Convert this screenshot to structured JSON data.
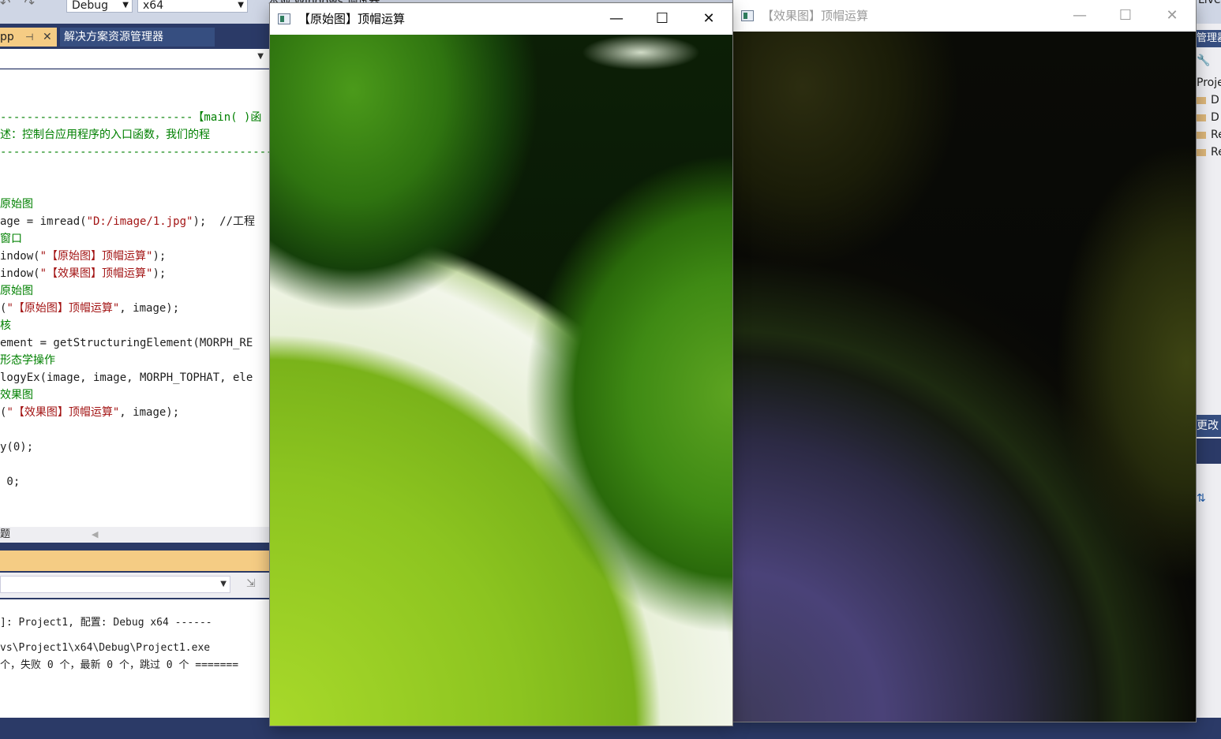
{
  "vs": {
    "toolbar": {
      "nav_arrows": "↶ ↷",
      "config": "Debug",
      "platform": "x64",
      "run_target": "本地 Windows 调试器",
      "live_share": "Live"
    },
    "tabs": {
      "cpp_tab": "pp",
      "pin_glyph": "⊣",
      "close_glyph": "✕",
      "solution_explorer": "解决方案资源管理器"
    },
    "code_lines": [
      {
        "text": "-----------------------------【main( )函",
        "color": "green"
      },
      {
        "text": "述：控制台应用程序的入口函数，我们的程",
        "color": "green"
      },
      {
        "text": "------------------------------------------",
        "color": "green"
      },
      {
        "text": "",
        "color": "dark"
      },
      {
        "text": "",
        "color": "dark"
      },
      {
        "text": "原始图",
        "color": "green"
      },
      {
        "text": "age = imread(\"D:/image/1.jpg\");  //工程",
        "color": "dark"
      },
      {
        "text": "窗口",
        "color": "green"
      },
      {
        "text": "indow(\"【原始图】顶帽运算\");",
        "color": "dark"
      },
      {
        "text": "indow(\"【效果图】顶帽运算\");",
        "color": "dark"
      },
      {
        "text": "原始图",
        "color": "green"
      },
      {
        "text": "(\"【原始图】顶帽运算\", image);",
        "color": "dark"
      },
      {
        "text": "核",
        "color": "green"
      },
      {
        "text": "ement = getStructuringElement(MORPH_RE",
        "color": "dark"
      },
      {
        "text": "形态学操作",
        "color": "green"
      },
      {
        "text": "logyEx(image, image, MORPH_TOPHAT, ele",
        "color": "dark"
      },
      {
        "text": "效果图",
        "color": "green"
      },
      {
        "text": "(\"【效果图】顶帽运算\", image);",
        "color": "dark"
      },
      {
        "text": "",
        "color": "dark"
      },
      {
        "text": "y(0);",
        "color": "dark"
      },
      {
        "text": "",
        "color": "dark"
      },
      {
        "text": " 0;",
        "color": "dark"
      }
    ],
    "editor_status": "题",
    "output_lines": [
      "]: Project1, 配置: Debug x64 ------",
      "",
      "vs\\Project1\\x64\\Debug\\Project1.exe",
      "个，失败 0 个，最新 0 个，跳过 0 个 =======",
      ""
    ],
    "right_panel": {
      "header": "管理器",
      "project": "Proje",
      "folders": [
        "D",
        "D",
        "Re",
        "Re"
      ],
      "band_label": "更改"
    }
  },
  "windows": {
    "original": {
      "title": "【原始图】顶帽运算",
      "minimize": "—",
      "maximize": "☐",
      "close": "✕"
    },
    "effect": {
      "title": "【效果图】顶帽运算",
      "minimize": "—",
      "maximize": "☐",
      "close": "✕"
    }
  },
  "colors": {
    "vs_frame": "#2b3a67",
    "active_tab": "#f5cc84",
    "comment_green": "#008000",
    "string_red": "#a31515"
  }
}
